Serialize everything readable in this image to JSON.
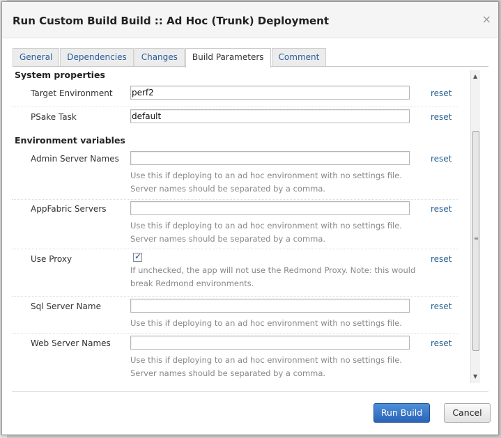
{
  "dialog": {
    "title": "Run Custom Build Build :: Ad Hoc (Trunk) Deployment",
    "close_label": "×"
  },
  "tabs": [
    {
      "label": "General",
      "active": false
    },
    {
      "label": "Dependencies",
      "active": false
    },
    {
      "label": "Changes",
      "active": false
    },
    {
      "label": "Build Parameters",
      "active": true
    },
    {
      "label": "Comment",
      "active": false
    }
  ],
  "sections": {
    "system_properties": "System properties",
    "environment_variables": "Environment variables"
  },
  "params": {
    "target_environment": {
      "label": "Target Environment",
      "value": "perf2",
      "reset": "reset"
    },
    "psake_task": {
      "label": "PSake Task",
      "value": "default",
      "reset": "reset"
    },
    "admin_server_names": {
      "label": "Admin Server Names",
      "value": "",
      "reset": "reset",
      "help1": "Use this if deploying to an ad hoc environment with no settings file.",
      "help2": "Server names should be separated by a comma."
    },
    "appfabric_servers": {
      "label": "AppFabric Servers",
      "value": "",
      "reset": "reset",
      "help1": "Use this if deploying to an ad hoc environment with no settings file.",
      "help2": "Server names should be separated by a comma."
    },
    "use_proxy": {
      "label": "Use Proxy",
      "checked": true,
      "reset": "reset",
      "help1": "If unchecked, the app will not use the Redmond Proxy. Note: this would",
      "help2": "break Redmond environments."
    },
    "sql_server_name": {
      "label": "Sql Server Name",
      "value": "",
      "reset": "reset",
      "help1": "Use this if deploying to an ad hoc environment with no settings file."
    },
    "web_server_names": {
      "label": "Web Server Names",
      "value": "",
      "reset": "reset",
      "help1": "Use this if deploying to an ad hoc environment with no settings file.",
      "help2": "Server names should be separated by a comma."
    }
  },
  "footer": {
    "run_build_label": "Run Build",
    "cancel_label": "Cancel"
  },
  "colors": {
    "link": "#2a6496",
    "primary_button": "#2a64b8",
    "help_text": "#888888"
  }
}
